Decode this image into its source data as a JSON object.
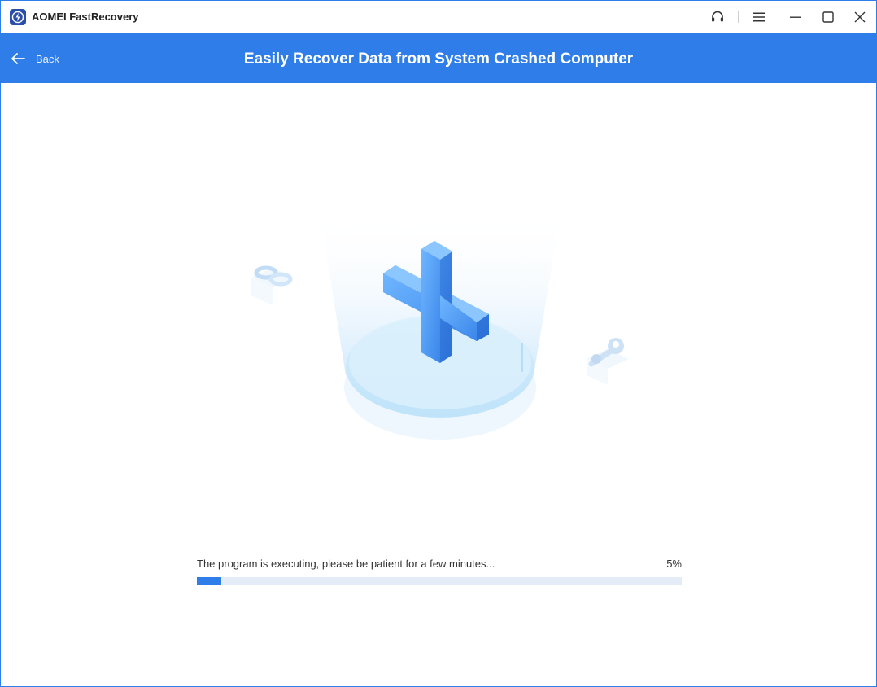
{
  "window": {
    "title": "AOMEI FastRecovery"
  },
  "titlebar": {
    "support_icon": "headset-icon",
    "menu_icon": "hamburger-menu-icon",
    "minimize_icon": "minimize-icon",
    "maximize_icon": "maximize-icon",
    "close_icon": "close-icon"
  },
  "header": {
    "back_label": "Back",
    "title": "Easily Recover Data from System Crashed Computer"
  },
  "progress": {
    "message": "The program is executing, please be patient for a few minutes...",
    "percent_label": "5%",
    "percent": 5
  },
  "colors": {
    "accent": "#2f7de8",
    "track": "#e3ecf7"
  }
}
